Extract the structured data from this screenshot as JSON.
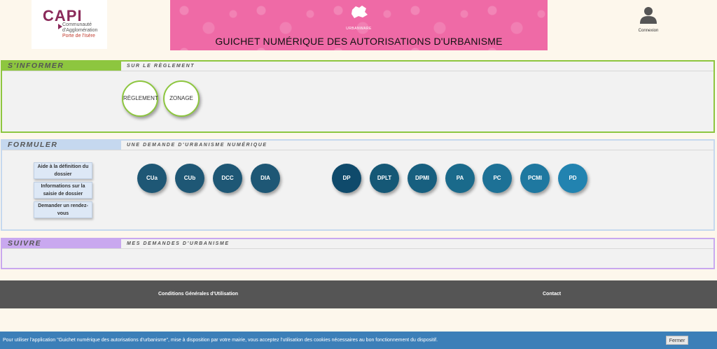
{
  "header": {
    "logo": {
      "name": "CAPI",
      "line1": "Communauté",
      "line2": "d'Agglomération",
      "line3": "Porte de l'Isère"
    },
    "banner": {
      "small_label": "URBANWARE",
      "title": "GUICHET NUMÉRIQUE DES AUTORISATIONS D'URBANISME",
      "color": "#ef6aa6"
    },
    "login_label": "Connexion"
  },
  "sections": {
    "inform": {
      "tab": "S'INFORMER",
      "subtitle": "SUR LE RÈGLEMENT",
      "buttons": [
        "RÈGLEMENT",
        "ZONAGE"
      ],
      "color": "#8dc63f"
    },
    "form": {
      "tab": "FORMULER",
      "subtitle": "UNE DEMANDE D'URBANISME NUMÉRIQUE",
      "side_buttons": [
        "Aide à la définition du dossier",
        "Informations sur la saisie de dossier",
        "Demander un rendez-vous"
      ],
      "group1": [
        "CUa",
        "CUb",
        "DCC",
        "DIA"
      ],
      "group2": [
        "DP",
        "DPLT",
        "DPMI",
        "PA",
        "PC",
        "PCMI",
        "PD"
      ],
      "color": "#c5d8ef"
    },
    "follow": {
      "tab": "SUIVRE",
      "subtitle": "MES DEMANDES D'URBANISME",
      "color": "#c9a8ef"
    }
  },
  "footer": {
    "cgu": "Conditions Générales d'Utilisation",
    "contact": "Contact"
  },
  "cookie": {
    "text": "Pour utiliser l'application \"Guichet numérique des autorisations d'urbanisme\", mise à disposition par votre mairie, vous acceptez l'utilisation des cookies nécessaires au bon fonctionnement du dispositif.",
    "button": "Fermer"
  }
}
